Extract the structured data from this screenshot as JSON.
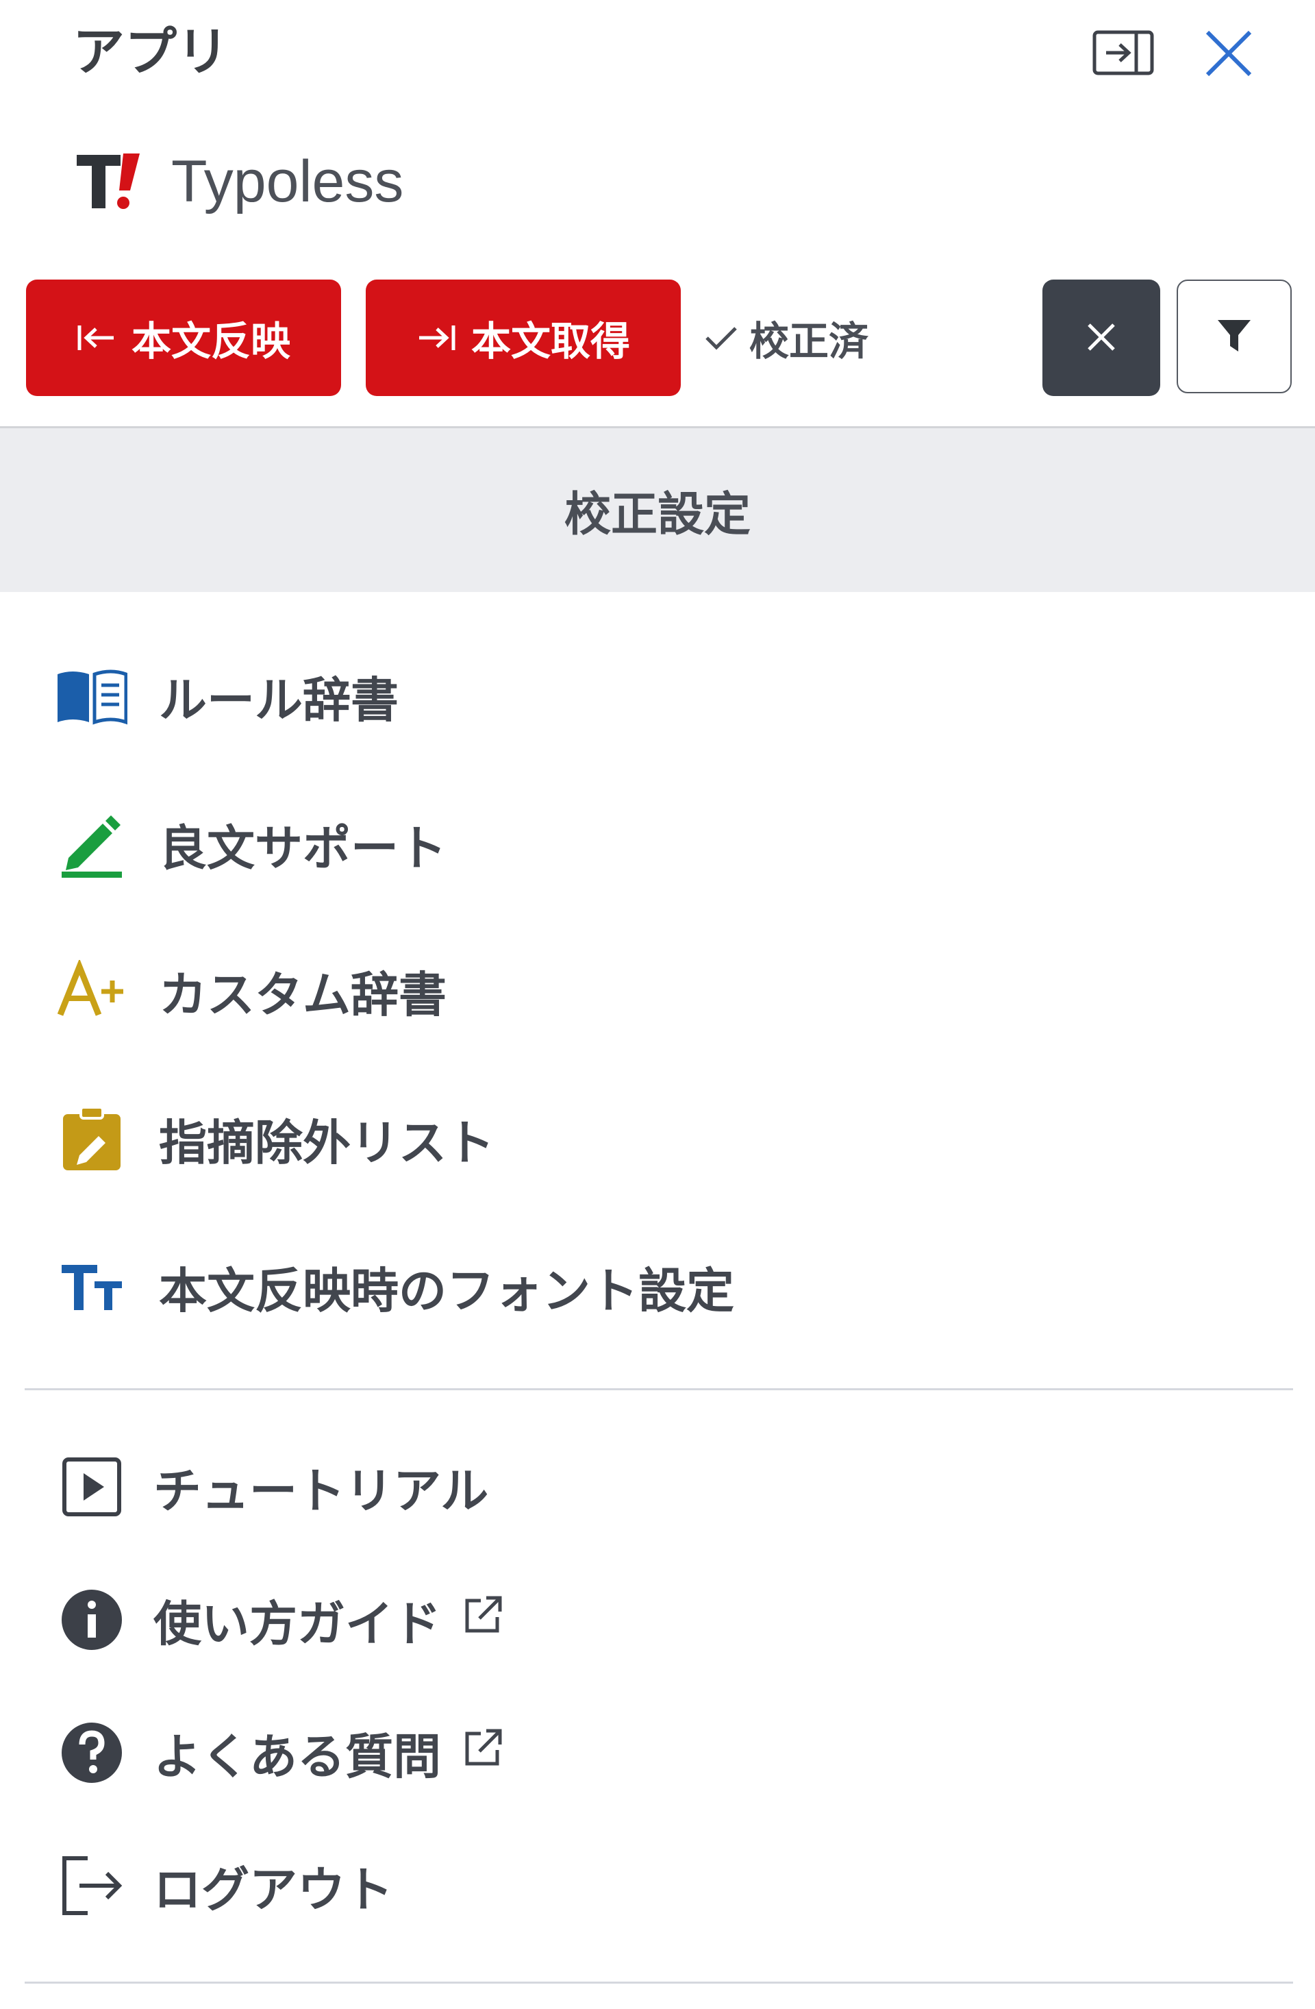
{
  "panel": {
    "title": "アプリ",
    "icons": {
      "dock": "dock-panel-icon",
      "close": "close-icon"
    }
  },
  "app": {
    "logo_text": "T!",
    "name": "Typoless"
  },
  "toolbar": {
    "apply_label": "本文反映",
    "fetch_label": "本文取得",
    "status_label": "校正済",
    "clear_icon": "x-icon",
    "filter_icon": "filter-icon"
  },
  "settings": {
    "header": "校正設定",
    "items": [
      {
        "label": "ルール辞書",
        "icon": "book-icon",
        "color": "#1b5eaa"
      },
      {
        "label": "良文サポート",
        "icon": "pencil-icon",
        "color": "#1a9e3f"
      },
      {
        "label": "カスタム辞書",
        "icon": "a-plus-icon",
        "color": "#c9a117"
      },
      {
        "label": "指摘除外リスト",
        "icon": "clipboard-edit-icon",
        "color": "#c49a17"
      },
      {
        "label": "本文反映時のフォント設定",
        "icon": "text-size-icon",
        "color": "#1b5eaa"
      }
    ]
  },
  "help": {
    "items": [
      {
        "label": "チュートリアル",
        "icon": "play-square-icon",
        "external": false
      },
      {
        "label": "使い方ガイド",
        "icon": "info-circle-icon",
        "external": true
      },
      {
        "label": "よくある質問",
        "icon": "question-circle-icon",
        "external": true
      },
      {
        "label": "ログアウト",
        "icon": "logout-icon",
        "external": false
      }
    ]
  },
  "colors": {
    "brand_red": "#d41217",
    "dark_button": "#3d424b",
    "section_bg": "#ecedf0",
    "close_blue": "#2f6fd0"
  }
}
